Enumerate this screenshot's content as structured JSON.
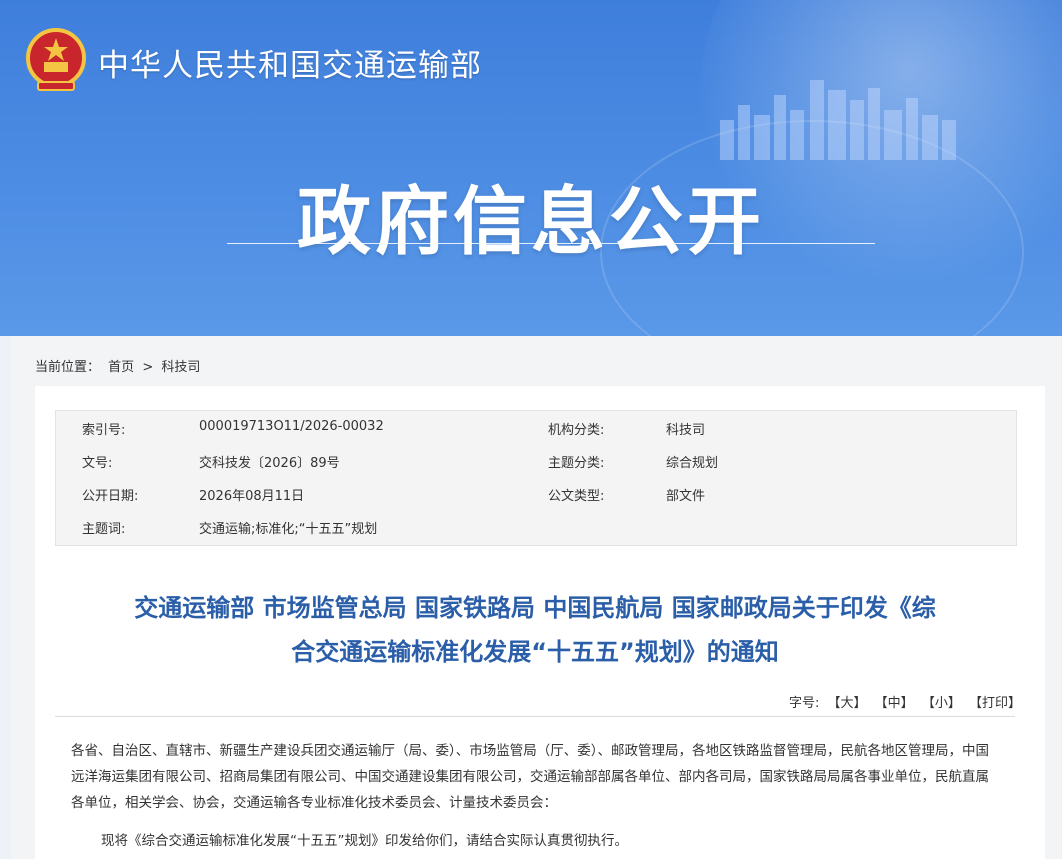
{
  "header": {
    "ministry_name": "中华人民共和国交通运输部",
    "section_title": "政府信息公开"
  },
  "breadcrumb": {
    "label": "当前位置：",
    "home": "首页",
    "separator": ">",
    "current": "科技司"
  },
  "meta": {
    "rows": [
      {
        "k1": "索引号:",
        "v1": "000019713O11/2026-00032",
        "k2": "机构分类:",
        "v2": "科技司"
      },
      {
        "k1": "文号:",
        "v1": "交科技发〔2026〕89号",
        "k2": "主题分类:",
        "v2": "综合规划"
      },
      {
        "k1": "公开日期:",
        "v1": "2026年08月11日",
        "k2": "公文类型:",
        "v2": "部文件"
      },
      {
        "k1": "主题词:",
        "v1": "交通运输;标准化;“十五五”规划",
        "k2": "",
        "v2": ""
      }
    ]
  },
  "document": {
    "title_line1": "交通运输部 市场监管总局 国家铁路局 中国民航局 国家邮政局关于印发《综",
    "title_line2": "合交通运输标准化发展“十五五”规划》的通知",
    "fontsize_label": "字号:",
    "fontsize_large": "【大】",
    "fontsize_medium": "【中】",
    "fontsize_small": "【小】",
    "print": "【打印】",
    "paragraph1": "各省、自治区、直辖市、新疆生产建设兵团交通运输厅（局、委）、市场监管局（厅、委）、邮政管理局，各地区铁路监督管理局，民航各地区管理局，中国远洋海运集团有限公司、招商局集团有限公司、中国交通建设集团有限公司，交通运输部部属各单位、部内各司局，国家铁路局局属各事业单位，民航直属各单位，相关学会、协会，交通运输各专业标准化技术委员会、计量技术委员会：",
    "paragraph2": "现将《综合交通运输标准化发展“十五五”规划》印发给你们，请结合实际认真贯彻执行。"
  },
  "colors": {
    "banner_blue": "#4a8ae2",
    "title_blue": "#2a5ea8"
  }
}
